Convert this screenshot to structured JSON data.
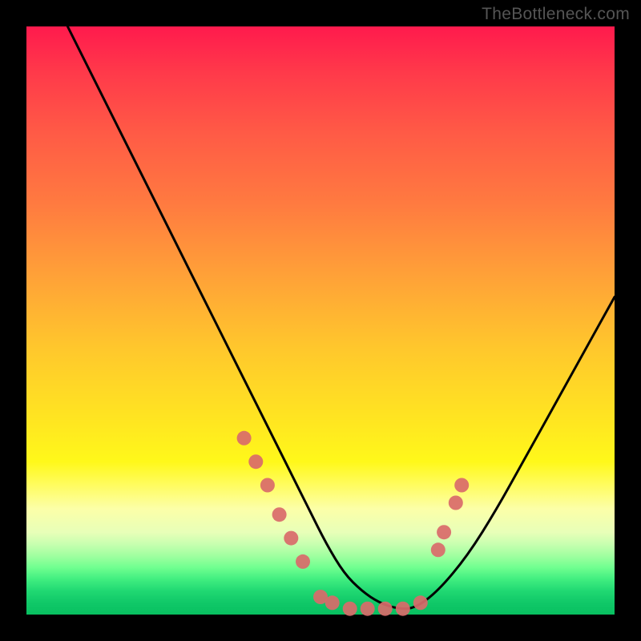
{
  "watermark": "TheBottleneck.com",
  "chart_data": {
    "type": "line",
    "title": "",
    "xlabel": "",
    "ylabel": "",
    "xlim": [
      0,
      100
    ],
    "ylim": [
      0,
      100
    ],
    "grid": false,
    "legend": false,
    "series": [
      {
        "name": "bottleneck-curve",
        "color": "#000000",
        "x": [
          7,
          10,
          14,
          18,
          22,
          26,
          30,
          34,
          38,
          42,
          45,
          48,
          51,
          54,
          57,
          60,
          63,
          66,
          70,
          75,
          80,
          85,
          90,
          95,
          100
        ],
        "y": [
          100,
          94,
          86,
          78,
          70,
          62,
          54,
          46,
          38,
          30,
          24,
          18,
          12,
          7,
          4,
          2,
          1,
          1,
          4,
          10,
          18,
          27,
          36,
          45,
          54
        ]
      }
    ],
    "marker_clusters": [
      {
        "name": "left-cluster",
        "color": "#d96a6a",
        "points": [
          {
            "x": 37,
            "y": 30
          },
          {
            "x": 39,
            "y": 26
          },
          {
            "x": 41,
            "y": 22
          },
          {
            "x": 43,
            "y": 17
          },
          {
            "x": 45,
            "y": 13
          },
          {
            "x": 47,
            "y": 9
          }
        ]
      },
      {
        "name": "bottom-cluster",
        "color": "#d96a6a",
        "points": [
          {
            "x": 50,
            "y": 3
          },
          {
            "x": 52,
            "y": 2
          },
          {
            "x": 55,
            "y": 1
          },
          {
            "x": 58,
            "y": 1
          },
          {
            "x": 61,
            "y": 1
          },
          {
            "x": 64,
            "y": 1
          },
          {
            "x": 67,
            "y": 2
          }
        ]
      },
      {
        "name": "right-cluster",
        "color": "#d96a6a",
        "points": [
          {
            "x": 70,
            "y": 11
          },
          {
            "x": 71,
            "y": 14
          },
          {
            "x": 73,
            "y": 19
          },
          {
            "x": 74,
            "y": 22
          }
        ]
      }
    ],
    "gradient": {
      "top": "#ff1a4d",
      "middle": "#ffe820",
      "bottom": "#10c868"
    }
  }
}
